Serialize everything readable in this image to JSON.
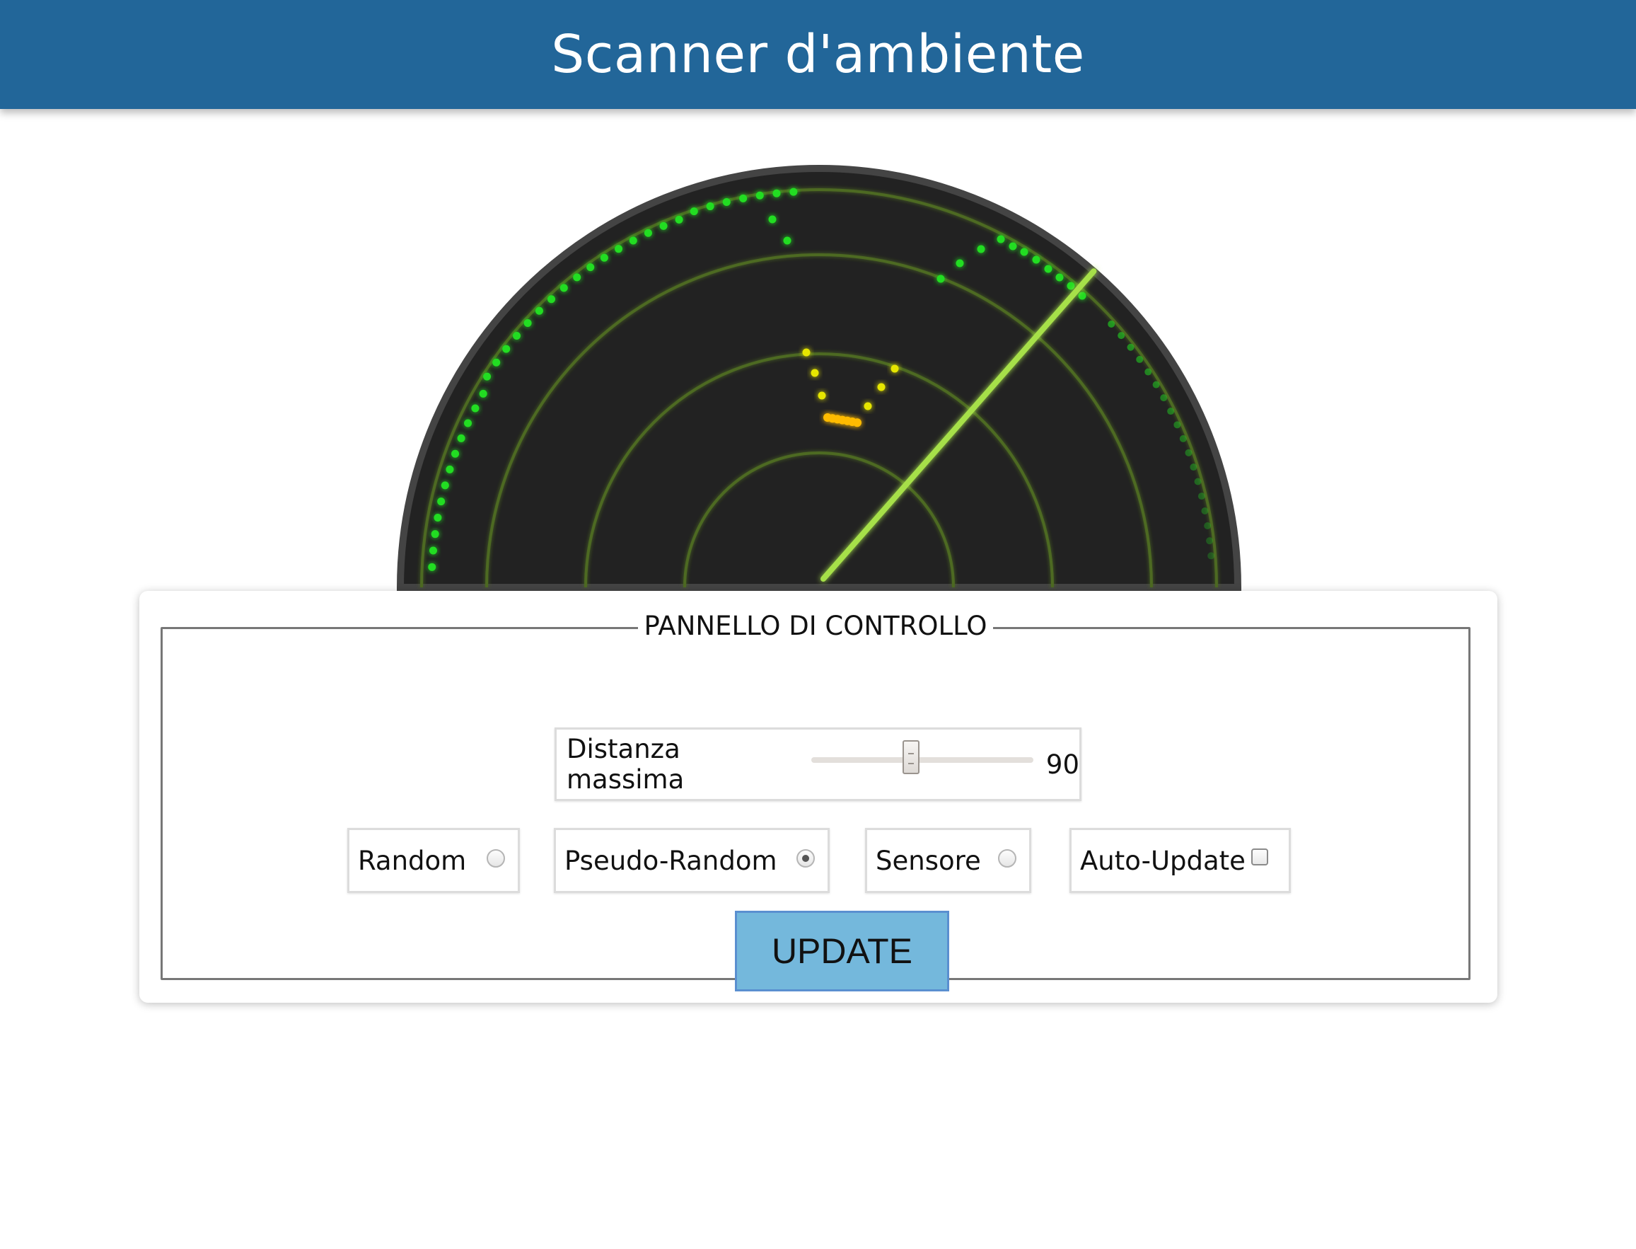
{
  "header": {
    "title": "Scanner d'ambiente"
  },
  "radar": {
    "colors": {
      "background": "#222222",
      "rim": "#444444",
      "rings": "#4e6a22",
      "sweep": "#a6e04a",
      "outer_points": "#22dd22",
      "inner_points": "#e6e600",
      "center_points": "#ffbb00"
    },
    "sweep_angle_deg": 49,
    "ring_count": 4,
    "max_distance": 90
  },
  "panel": {
    "legend": "PANNELLO DI CONTROLLO",
    "slider": {
      "label": "Distanza massima",
      "value": "90",
      "fill": 0.45
    },
    "modes": [
      {
        "label": "Random",
        "checked": false
      },
      {
        "label": "Pseudo-Random",
        "checked": true
      },
      {
        "label": "Sensore",
        "checked": false
      }
    ],
    "auto_update": {
      "label": "Auto-Update",
      "checked": false
    },
    "update_button": "UPDATE"
  }
}
